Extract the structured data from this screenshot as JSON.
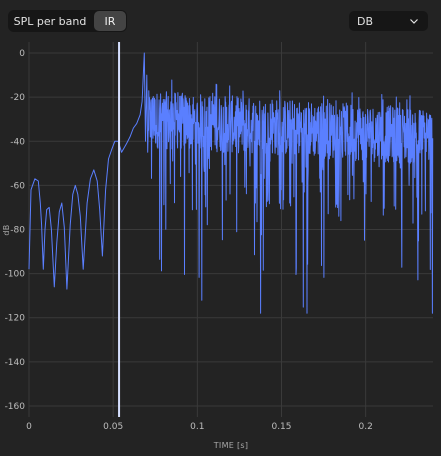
{
  "tabs": [
    {
      "label": "SPL per band",
      "active": false
    },
    {
      "label": "IR",
      "active": true
    }
  ],
  "dropdown": {
    "value": "DB",
    "icon": "chevron-down-icon"
  },
  "colors": {
    "series": "#5a7fff",
    "cursor": "#d6e0ff",
    "grid": "#3a3a3a",
    "background": "#232323"
  },
  "chart_data": {
    "type": "line",
    "xlabel": "TIME [s]",
    "ylabel": "dB",
    "xlim": [
      0,
      0.24
    ],
    "ylim": [
      -165,
      5
    ],
    "x_ticks": [
      {
        "value": 0,
        "label": "0"
      },
      {
        "value": 0.05,
        "label": "0.05"
      },
      {
        "value": 0.1,
        "label": "0.1"
      },
      {
        "value": 0.15,
        "label": "0.15"
      },
      {
        "value": 0.2,
        "label": "0.2"
      }
    ],
    "y_ticks": [
      {
        "value": 0,
        "label": "0"
      },
      {
        "value": -20,
        "label": "-20"
      },
      {
        "value": -40,
        "label": "-40"
      },
      {
        "value": -60,
        "label": "-60"
      },
      {
        "value": -80,
        "label": "-80"
      },
      {
        "value": -100,
        "label": "-100"
      },
      {
        "value": -120,
        "label": "-120"
      },
      {
        "value": -140,
        "label": "-140"
      },
      {
        "value": -160,
        "label": "-160"
      }
    ],
    "grid": true,
    "cursor_x": 0.0535,
    "series": [
      {
        "points": [
          [
            0,
            -98
          ],
          [
            0.0012,
            -62
          ],
          [
            0.0035,
            -57
          ],
          [
            0.0055,
            -58
          ],
          [
            0.0067,
            -68
          ],
          [
            0.0075,
            -78
          ],
          [
            0.0085,
            -98
          ],
          [
            0.0095,
            -80
          ],
          [
            0.0105,
            -71
          ],
          [
            0.012,
            -70
          ],
          [
            0.0133,
            -80
          ],
          [
            0.015,
            -106
          ],
          [
            0.0165,
            -86
          ],
          [
            0.018,
            -72
          ],
          [
            0.0195,
            -68
          ],
          [
            0.021,
            -79
          ],
          [
            0.0225,
            -107
          ],
          [
            0.0245,
            -78
          ],
          [
            0.026,
            -64
          ],
          [
            0.0275,
            -60
          ],
          [
            0.029,
            -64
          ],
          [
            0.0305,
            -74
          ],
          [
            0.0322,
            -98
          ],
          [
            0.0345,
            -68
          ],
          [
            0.0365,
            -57
          ],
          [
            0.0385,
            -53
          ],
          [
            0.0405,
            -58
          ],
          [
            0.042,
            -71
          ],
          [
            0.0436,
            -92
          ],
          [
            0.0455,
            -62
          ],
          [
            0.0472,
            -48
          ],
          [
            0.049,
            -44
          ],
          [
            0.051,
            -40
          ],
          [
            0.053,
            -40
          ],
          [
            0.055,
            -45
          ],
          [
            0.058,
            -41
          ],
          [
            0.06,
            -38
          ],
          [
            0.062,
            -34
          ],
          [
            0.064,
            -32
          ],
          [
            0.066,
            -28
          ],
          [
            0.0672,
            -22
          ],
          [
            0.0685,
            0
          ],
          [
            0.0692,
            -40
          ],
          [
            0.07,
            -10
          ],
          [
            0.0705,
            -45
          ],
          [
            0.0708,
            -35
          ]
        ]
      }
    ]
  }
}
